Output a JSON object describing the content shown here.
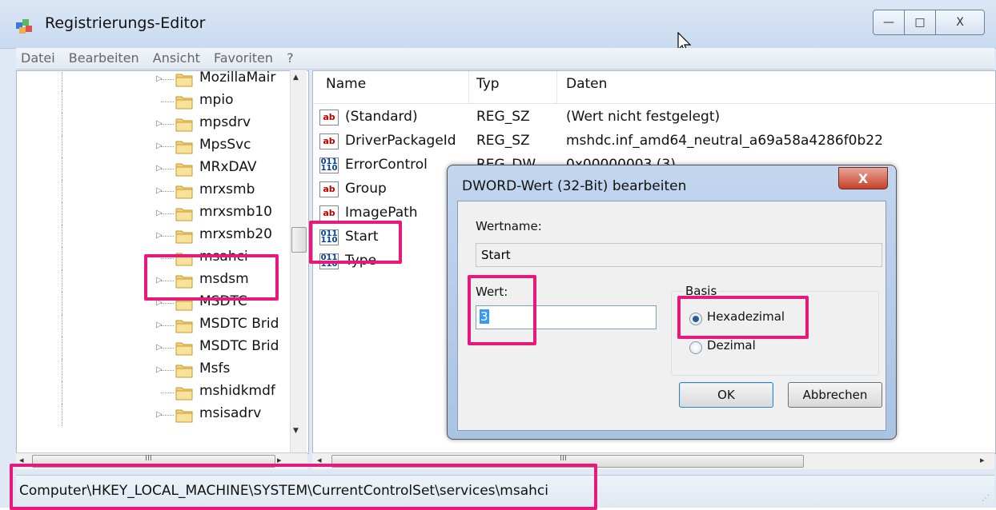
{
  "window": {
    "title": "Registrierungs-Editor",
    "controls": {
      "minimize": "—",
      "maximize": "□",
      "close": "X"
    }
  },
  "menu": [
    "Datei",
    "Bearbeiten",
    "Ansicht",
    "Favoriten",
    "?"
  ],
  "tree": {
    "items": [
      {
        "label": "MozillaMair",
        "expandable": true
      },
      {
        "label": "mpio",
        "expandable": false
      },
      {
        "label": "mpsdrv",
        "expandable": true
      },
      {
        "label": "MpsSvc",
        "expandable": true
      },
      {
        "label": "MRxDAV",
        "expandable": true
      },
      {
        "label": "mrxsmb",
        "expandable": true
      },
      {
        "label": "mrxsmb10",
        "expandable": true
      },
      {
        "label": "mrxsmb20",
        "expandable": true
      },
      {
        "label": "msahci",
        "expandable": false
      },
      {
        "label": "msdsm",
        "expandable": true
      },
      {
        "label": "MSDTC",
        "expandable": true
      },
      {
        "label": "MSDTC Brid",
        "expandable": true
      },
      {
        "label": "MSDTC Brid",
        "expandable": true
      },
      {
        "label": "Msfs",
        "expandable": true
      },
      {
        "label": "mshidkmdf",
        "expandable": false
      },
      {
        "label": "msisadrv",
        "expandable": true
      }
    ]
  },
  "list": {
    "headers": {
      "name": "Name",
      "type": "Typ",
      "data": "Daten"
    },
    "rows": [
      {
        "icon": "ab",
        "name": "(Standard)",
        "type": "REG_SZ",
        "data": "(Wert nicht festgelegt)"
      },
      {
        "icon": "ab",
        "name": "DriverPackageId",
        "type": "REG_SZ",
        "data": "mshdc.inf_amd64_neutral_a69a58a4286f0b22"
      },
      {
        "icon": "bin",
        "name": "ErrorControl",
        "type": "REG_DW",
        "data": "0x00000003 (3)"
      },
      {
        "icon": "ab",
        "name": "Group",
        "type": "",
        "data": ""
      },
      {
        "icon": "ab",
        "name": "ImagePath",
        "type": "",
        "data": ""
      },
      {
        "icon": "bin",
        "name": "Start",
        "type": "",
        "data": ""
      },
      {
        "icon": "bin",
        "name": "Type",
        "type": "",
        "data": ""
      }
    ]
  },
  "status": {
    "path": "Computer\\HKEY_LOCAL_MACHINE\\SYSTEM\\CurrentControlSet\\services\\msahci"
  },
  "scrollbar": {
    "h_left_glyph": "◂",
    "h_right_glyph": "▸",
    "h_thumb_glyph": "III",
    "v_up_glyph": "▲",
    "v_down_glyph": "▼"
  },
  "dialog": {
    "title": "DWORD-Wert (32-Bit) bearbeiten",
    "close_glyph": "X",
    "name_label": "Wertname:",
    "name_value": "Start",
    "value_label": "Wert:",
    "value": "3",
    "base_label": "Basis",
    "radio_hex": "Hexadezimal",
    "radio_dec": "Dezimal",
    "selected_base": "Hexadezimal",
    "ok": "OK",
    "cancel": "Abbrechen"
  },
  "icons": {
    "app": "registry-editor-icon",
    "folder": "folder-icon",
    "string_value": "string-value-icon",
    "binary_value": "dword-value-icon"
  }
}
